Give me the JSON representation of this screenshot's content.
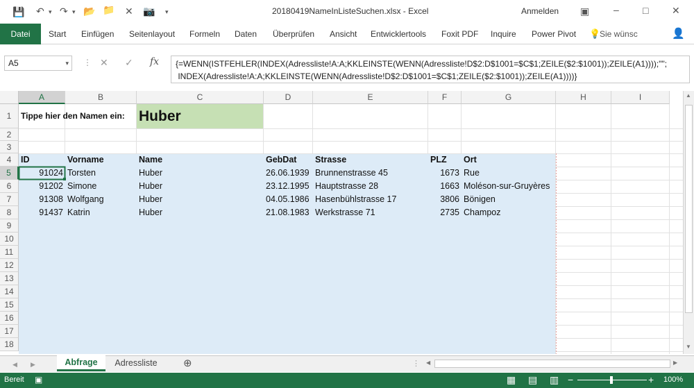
{
  "window": {
    "title": "20180419NameInListeSuchen.xlsx  -  Excel",
    "account": "Anmelden"
  },
  "ribbon": {
    "file": "Datei",
    "tabs": [
      "Start",
      "Einfügen",
      "Seitenlayout",
      "Formeln",
      "Daten",
      "Überprüfen",
      "Ansicht",
      "Entwicklertools",
      "Foxit PDF",
      "Inquire",
      "Power Pivot"
    ],
    "tell_me": "Sie wünsc"
  },
  "formula_bar": {
    "name_box": "A5",
    "formula_line1": "{=WENN(ISTFEHLER(INDEX(Adressliste!A:A;KKLEINSTE(WENN(Adressliste!D$2:D$1001=$C$1;ZEILE($2:$1001));ZEILE(A1))));\"\";",
    "formula_line2": " INDEX(Adressliste!A:A;KKLEINSTE(WENN(Adressliste!D$2:D$1001=$C$1;ZEILE($2:$1001));ZEILE(A1))))}"
  },
  "columns": [
    "A",
    "B",
    "C",
    "D",
    "E",
    "F",
    "G",
    "H",
    "I"
  ],
  "rows": [
    "1",
    "2",
    "3",
    "4",
    "5",
    "6",
    "7",
    "8",
    "9",
    "10",
    "11",
    "12",
    "13",
    "14",
    "15",
    "16",
    "17",
    "18"
  ],
  "cells": {
    "a1": "Tippe hier den Namen ein:",
    "c1": "Huber",
    "headers": [
      "ID",
      "Vorname",
      "Name",
      "GebDat",
      "Strasse",
      "PLZ",
      "Ort"
    ],
    "data": [
      [
        "91024",
        "Torsten",
        "Huber",
        "26.06.1939",
        "Brunnenstrasse 45",
        "1673",
        "Rue"
      ],
      [
        "91202",
        "Simone",
        "Huber",
        "23.12.1995",
        "Hauptstrasse 28",
        "1663",
        "Moléson-sur-Gruyères"
      ],
      [
        "91308",
        "Wolfgang",
        "Huber",
        "04.05.1986",
        "Hasenbühlstrasse 17",
        "3806",
        "Bönigen"
      ],
      [
        "91437",
        "Katrin",
        "Huber",
        "21.08.1983",
        "Werkstrasse 71",
        "2735",
        "Champoz"
      ]
    ]
  },
  "sheets": [
    "Abfrage",
    "Adressliste"
  ],
  "status": {
    "ready": "Bereit",
    "zoom": "100%"
  },
  "colors": {
    "excel_green": "#217346",
    "input_fill": "#c6e0b4",
    "table_fill": "#ddebf7"
  }
}
